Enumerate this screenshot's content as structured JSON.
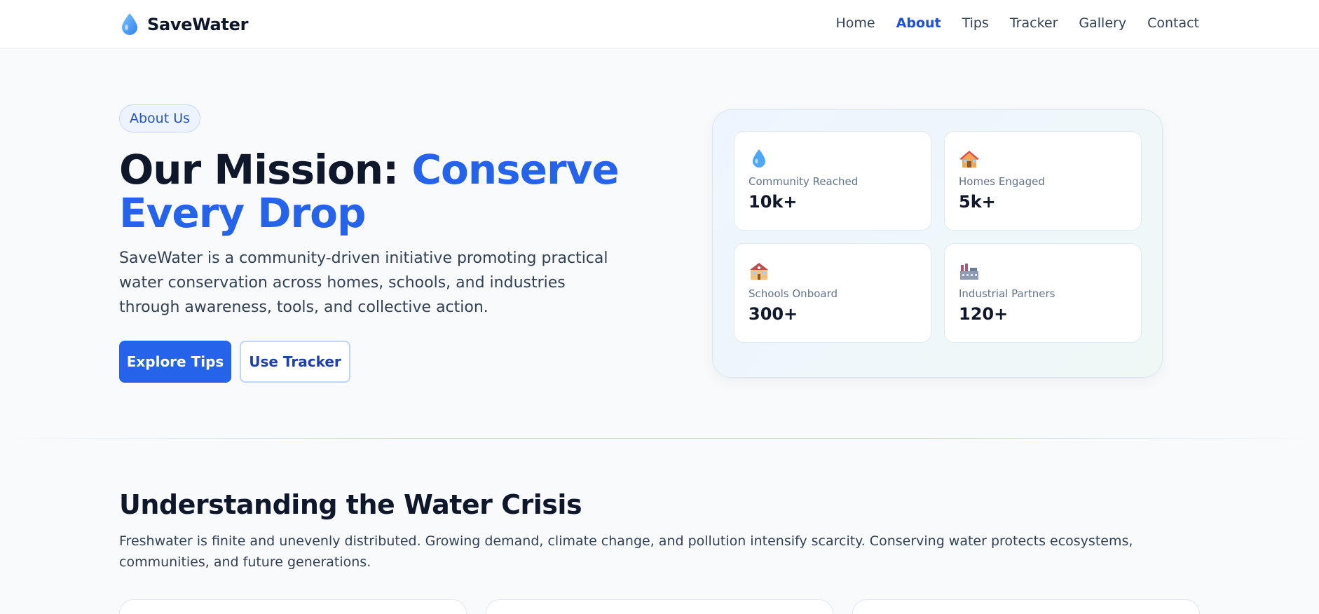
{
  "brand": {
    "name": "SaveWater",
    "icon": "water-drop-icon"
  },
  "nav": {
    "items": [
      {
        "label": "Home",
        "active": false
      },
      {
        "label": "About",
        "active": true
      },
      {
        "label": "Tips",
        "active": false
      },
      {
        "label": "Tracker",
        "active": false
      },
      {
        "label": "Gallery",
        "active": false
      },
      {
        "label": "Contact",
        "active": false
      }
    ]
  },
  "hero": {
    "pill": "About Us",
    "title_part1": "Our Mission: ",
    "title_accent": "Conserve Every Drop",
    "lead": "SaveWater is a community-driven initiative promoting practical water conservation across homes, schools, and industries through awareness, tools, and collective action.",
    "primary_button": "Explore Tips",
    "secondary_button": "Use Tracker"
  },
  "stats": [
    {
      "icon": "water-drop-icon",
      "label": "Community Reached",
      "value": "10k+"
    },
    {
      "icon": "house-icon",
      "label": "Homes Engaged",
      "value": "5k+"
    },
    {
      "icon": "school-icon",
      "label": "Schools Onboard",
      "value": "300+"
    },
    {
      "icon": "factory-icon",
      "label": "Industrial Partners",
      "value": "120+"
    }
  ],
  "crisis": {
    "title": "Understanding the Water Crisis",
    "text": "Freshwater is finite and unevenly distributed. Growing demand, climate change, and pollution intensify scarcity. Conserving water protects ecosystems, communities, and future generations."
  },
  "colors": {
    "accent": "#2563eb",
    "nav_active": "#1d4ed8",
    "text": "#0f172a",
    "muted": "#64748b"
  }
}
